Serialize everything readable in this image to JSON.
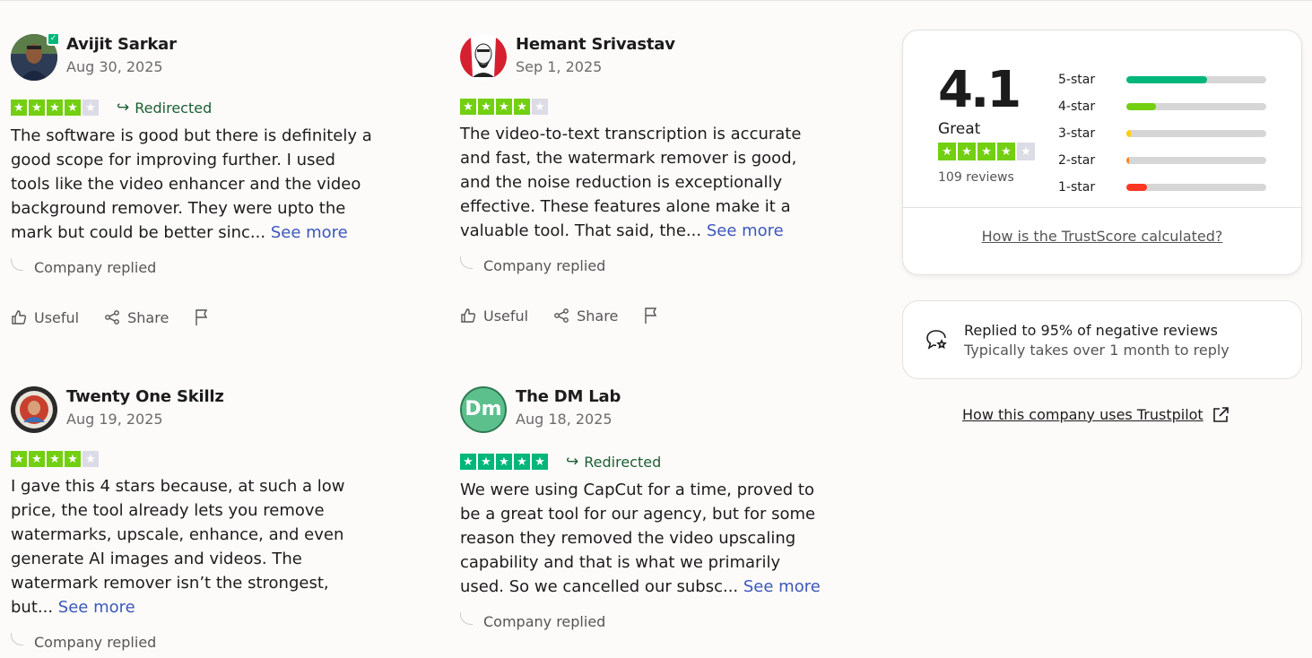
{
  "reviews": [
    {
      "name": "Avijit Sarkar",
      "date": "Aug 30, 2025",
      "stars": 4,
      "redirected": "Redirected",
      "text": "The software is good but there is definitely a good scope for improving further. I used tools like the video enhancer and the video background remover. They were upto the mark but could be better sinc...",
      "see_more": "See more",
      "company_replied": "Company replied",
      "useful": "Useful",
      "share": "Share"
    },
    {
      "name": "Hemant Srivastav",
      "date": "Sep 1, 2025",
      "stars": 4,
      "text": "The video-to-text transcription is accurate and fast, the watermark remover is good, and the noise reduction is exceptionally effective. These features alone make it a valuable tool. That said, the...",
      "see_more": "See more",
      "company_replied": "Company replied",
      "useful": "Useful",
      "share": "Share"
    },
    {
      "name": "Twenty One Skillz",
      "date": "Aug 19, 2025",
      "stars": 4,
      "text": "I gave this 4 stars because, at such a low price, the tool already lets you remove watermarks, upscale, enhance, and even generate AI images and videos. The watermark remover isn’t the strongest, but...",
      "see_more": "See more",
      "company_replied": "Company replied"
    },
    {
      "name": "The DM Lab",
      "avatar_initials": "Dm",
      "date": "Aug 18, 2025",
      "stars": 5,
      "redirected": "Redirected",
      "text": "We were using CapCut for a time, proved to be a great tool for our agency, but for some reason they removed the video upscaling capability and that is what we primarily used. So we cancelled our subsc...",
      "see_more": "See more",
      "company_replied": "Company replied"
    }
  ],
  "trustscore": {
    "score": "4.1",
    "label": "Great",
    "stars": 4,
    "reviews_count": "109 reviews",
    "distribution": [
      {
        "label": "5-star",
        "fraction": 0.58,
        "color": "#00b67a"
      },
      {
        "label": "4-star",
        "fraction": 0.21,
        "color": "#73cf11"
      },
      {
        "label": "3-star",
        "fraction": 0.03,
        "color": "#ffce00"
      },
      {
        "label": "2-star",
        "fraction": 0.02,
        "color": "#ff8622"
      },
      {
        "label": "1-star",
        "fraction": 0.15,
        "color": "#ff3722"
      }
    ],
    "calc_link": "How is the TrustScore calculated?"
  },
  "reply_stats": {
    "main": "Replied to 95% of negative reviews",
    "sub": "Typically takes over 1 month to reply"
  },
  "company_link": "How this company uses Trustpilot",
  "icons": {
    "redirect": "redirect-arrow-icon",
    "useful": "thumbs-up-icon",
    "share": "share-icon",
    "flag": "flag-icon",
    "reply": "speech-bubble-star-icon",
    "external": "external-link-icon"
  }
}
